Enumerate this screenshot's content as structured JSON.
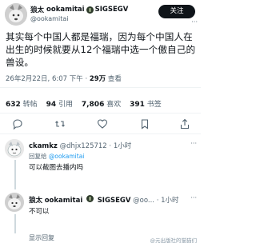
{
  "author": {
    "display_name": "狼太",
    "name_latin": "ookamitai",
    "name_suffix": "SIGSEGV",
    "handle": "@ookamitai"
  },
  "follow_label": "关注",
  "more_label": "···",
  "tweet": {
    "text": "其实每个中国人都是福瑞，因为每个中国人在出生的时候就要从12个福瑞中选一个傲自己的兽设。",
    "time": "26年2月22日, 6:07 下午",
    "dot": "·",
    "views_count": "29万",
    "views_label": "查看"
  },
  "stats": [
    {
      "count": "632",
      "label": "转帖"
    },
    {
      "count": "94",
      "label": "引用"
    },
    {
      "count": "7,806",
      "label": "喜欢"
    },
    {
      "count": "391",
      "label": "书签"
    }
  ],
  "replies": [
    {
      "display_name": "ckamkz",
      "handle": "@dhjx125712",
      "dot": "·",
      "time": "1小时",
      "reply_prefix": "回复给",
      "reply_to": "@ookamitai",
      "text": "可以截图去播内吗",
      "more": "···"
    },
    {
      "display_name": "狼太",
      "name_latin": "ookamitai",
      "name_suffix": "SIGSEGV",
      "handle": "@oo...",
      "dot": "·",
      "time": "1小时",
      "text": "不可以",
      "more": "···"
    }
  ],
  "reply_link": "显示回复",
  "watermark": "@元出版社的猫猫们"
}
